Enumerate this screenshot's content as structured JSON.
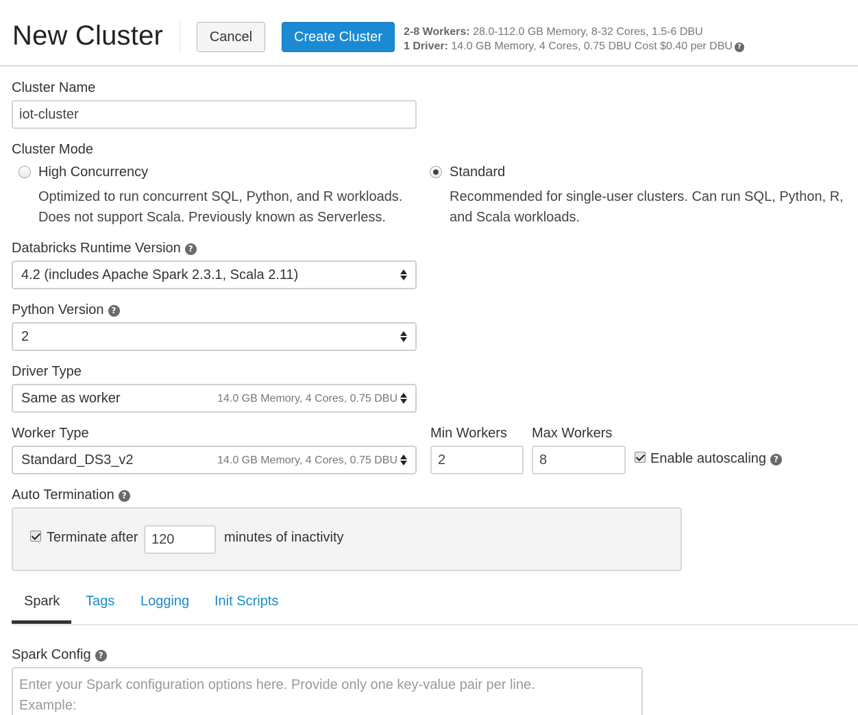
{
  "header": {
    "title": "New Cluster",
    "cancel_label": "Cancel",
    "create_label": "Create Cluster",
    "workers_summary_label": "2-8 Workers:",
    "workers_summary_value": "28.0-112.0 GB Memory, 8-32 Cores, 1.5-6 DBU",
    "driver_summary_label": "1 Driver:",
    "driver_summary_value": "14.0 GB Memory, 4 Cores, 0.75 DBU Cost $0.40 per DBU"
  },
  "cluster_name": {
    "label": "Cluster Name",
    "value": "iot-cluster"
  },
  "cluster_mode": {
    "label": "Cluster Mode",
    "options": [
      {
        "label": "High Concurrency",
        "selected": false,
        "desc_line1": "Optimized to run concurrent SQL, Python, and R workloads.",
        "desc_line2": "Does not support Scala. Previously known as Serverless."
      },
      {
        "label": "Standard",
        "selected": true,
        "desc_line1": "Recommended for single-user clusters. Can run SQL, Python, R,",
        "desc_line2": "and Scala workloads."
      }
    ]
  },
  "runtime": {
    "label": "Databricks Runtime Version",
    "value": "4.2 (includes Apache Spark 2.3.1, Scala 2.11)"
  },
  "python": {
    "label": "Python Version",
    "value": "2"
  },
  "driver_type": {
    "label": "Driver Type",
    "value": "Same as worker",
    "meta": "14.0 GB Memory, 4 Cores, 0.75 DBU"
  },
  "worker_type": {
    "label": "Worker Type",
    "value": "Standard_DS3_v2",
    "meta": "14.0 GB Memory, 4 Cores, 0.75 DBU"
  },
  "min_workers": {
    "label": "Min Workers",
    "value": "2"
  },
  "max_workers": {
    "label": "Max Workers",
    "value": "8"
  },
  "autoscaling": {
    "label": "Enable autoscaling",
    "checked": true
  },
  "auto_termination": {
    "label": "Auto Termination",
    "checkbox_label": "Terminate after",
    "checked": true,
    "minutes": "120",
    "suffix": "minutes of inactivity"
  },
  "tabs": [
    {
      "label": "Spark",
      "active": true
    },
    {
      "label": "Tags",
      "active": false
    },
    {
      "label": "Logging",
      "active": false
    },
    {
      "label": "Init Scripts",
      "active": false
    }
  ],
  "spark_config": {
    "label": "Spark Config",
    "placeholder_line1": "Enter your Spark configuration options here. Provide only one key-value pair per line.",
    "placeholder_line2": "Example:"
  },
  "icons": {
    "help": "question-circle-icon",
    "select_arrows": "sort-arrows-icon"
  },
  "colors": {
    "primary_button": "#1b8ad3",
    "tab_link": "#1a8ac8",
    "active_tab_underline": "#333333"
  }
}
